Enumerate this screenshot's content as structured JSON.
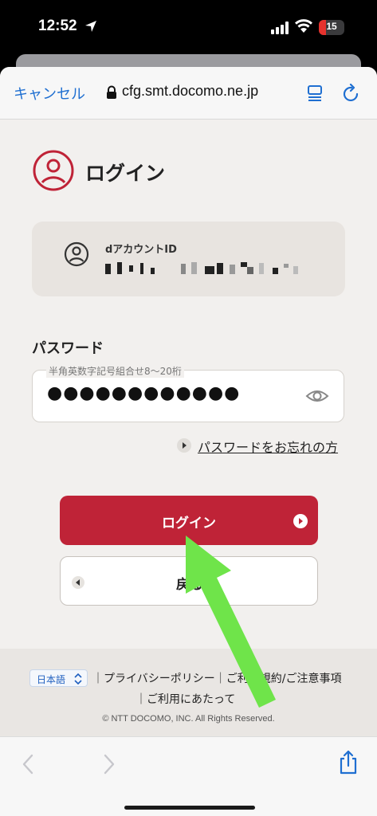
{
  "status_bar": {
    "time": "12:52",
    "battery": "15",
    "icons": [
      "location-arrow-icon",
      "signal-icon",
      "wifi-icon",
      "battery-icon"
    ]
  },
  "browser": {
    "cancel_label": "キャンセル",
    "url": "cfg.smt.docomo.ne.jp",
    "icons": [
      "lock-icon",
      "reader-icon",
      "reload-icon"
    ]
  },
  "page": {
    "title": "ログイン",
    "account": {
      "label": "dアカウントID"
    },
    "password": {
      "label": "パスワード",
      "placeholder": "半角英数字記号組合せ8〜20桁",
      "masked_value": "●●●●●●●●●●●●"
    },
    "forgot_link": "パスワードをお忘れの方",
    "login_button": "ログイン",
    "back_button": "戻る"
  },
  "footer": {
    "language": "日本語",
    "links": [
      "プライバシーポリシー",
      "ご利用規約/ご注意事項",
      "ご利用にあたって"
    ],
    "copyright": "© NTT DOCOMO, INC. All Rights Reserved."
  },
  "toolbar": {
    "icons": [
      "back-icon",
      "forward-icon",
      "share-icon"
    ]
  },
  "colors": {
    "brand_red": "#bf2337",
    "link_blue": "#1f6fd1",
    "annotation_green": "#6fe44a"
  }
}
